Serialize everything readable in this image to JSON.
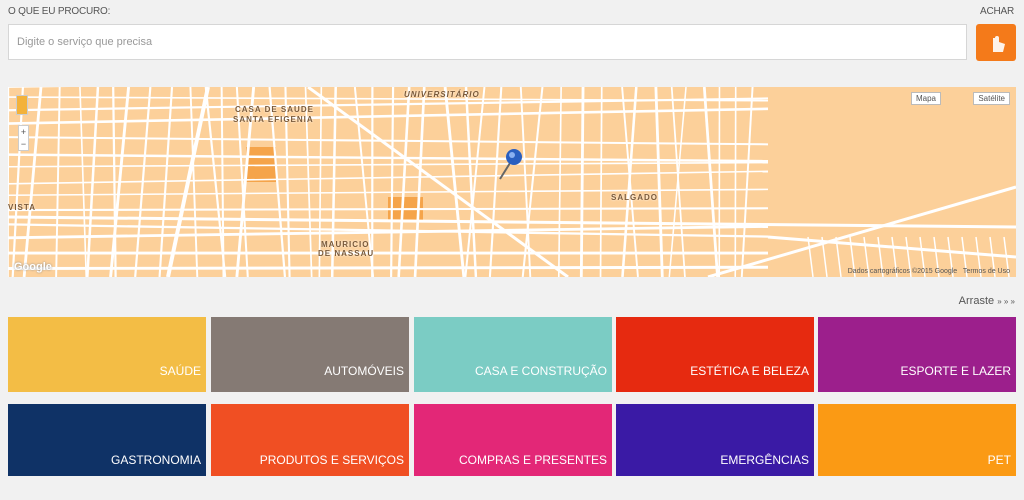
{
  "search": {
    "label": "O QUE EU PROCURO:",
    "placeholder": "Digite o serviço que precisa",
    "button_label": "ACHAR"
  },
  "map": {
    "labels": {
      "universitario": "UNIVERSITÁRIO",
      "casa1": "CASA DE SAUDE",
      "casa2": "SANTA EFIGENIA",
      "vista": "VISTA",
      "mauricio1": "MAURICIO",
      "mauricio2": "DE NASSAU",
      "salgado": "SALGADO"
    },
    "type_map": "Mapa",
    "type_satellite": "Satélite",
    "logo": "Google",
    "credits": "Dados cartográficos ©2015 Google",
    "terms": "Termos de Uso",
    "zoom_in": "+",
    "zoom_out": "−"
  },
  "drag_hint": "Arraste",
  "drag_arrows": "» » »",
  "categories": [
    {
      "label": "SAÚDE",
      "color": "#f3bd45"
    },
    {
      "label": "AUTOMÓVEIS",
      "color": "#857a74"
    },
    {
      "label": "CASA E CONSTRUÇÃO",
      "color": "#7bccc4"
    },
    {
      "label": "ESTÉTICA E BELEZA",
      "color": "#e62a10"
    },
    {
      "label": "ESPORTE E LAZER",
      "color": "#9c1f8c"
    },
    {
      "label": "GASTRONOMIA",
      "color": "#0f3266"
    },
    {
      "label": "PRODUTOS E SERVIÇOS",
      "color": "#f04f23"
    },
    {
      "label": "COMPRAS E PRESENTES",
      "color": "#e32777"
    },
    {
      "label": "EMERGÊNCIAS",
      "color": "#3a1aa5"
    },
    {
      "label": "PET",
      "color": "#fb9a14"
    }
  ]
}
